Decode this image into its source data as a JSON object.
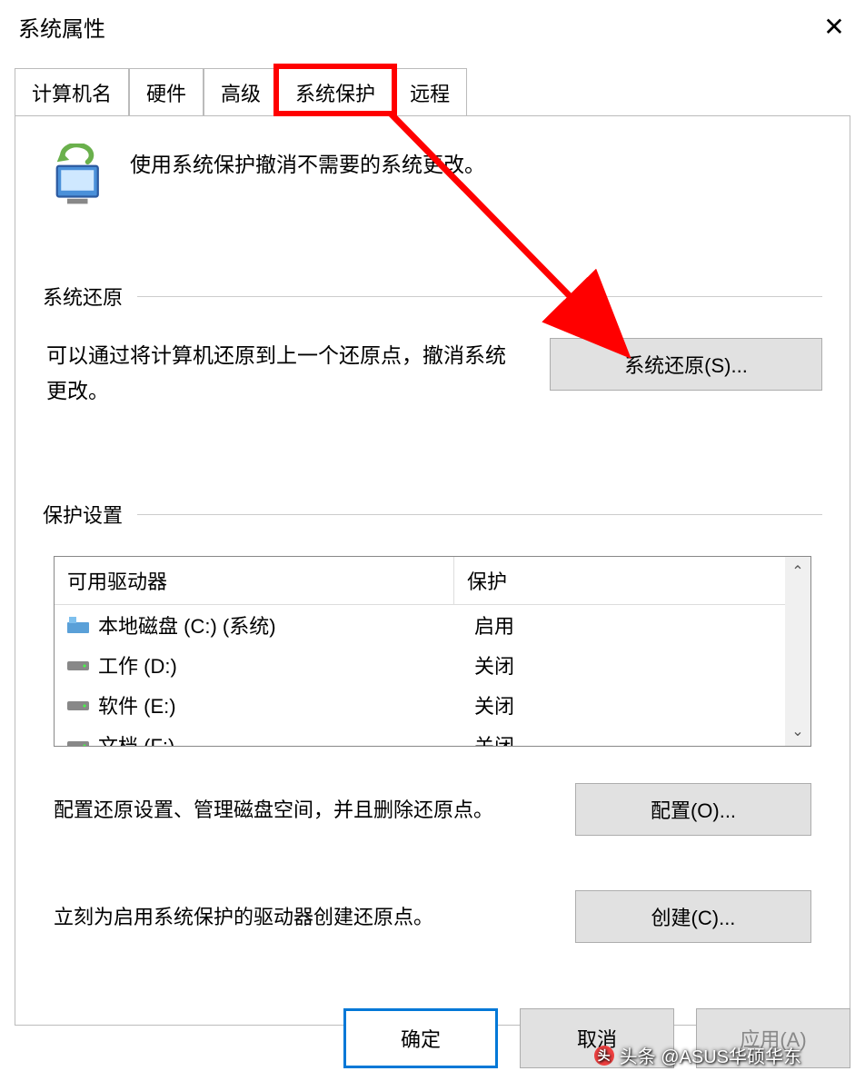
{
  "window": {
    "title": "系统属性"
  },
  "tabs": {
    "items": [
      {
        "label": "计算机名"
      },
      {
        "label": "硬件"
      },
      {
        "label": "高级"
      },
      {
        "label": "系统保护"
      },
      {
        "label": "远程"
      }
    ],
    "active_index": 3
  },
  "intro": {
    "text": "使用系统保护撤消不需要的系统更改。"
  },
  "restore_section": {
    "heading": "系统还原",
    "description": "可以通过将计算机还原到上一个还原点，撤消系统更改。",
    "button_label": "系统还原(S)..."
  },
  "protection_section": {
    "heading": "保护设置",
    "columns": {
      "drive": "可用驱动器",
      "status": "保护"
    },
    "drives": [
      {
        "name": "本地磁盘 (C:) (系统)",
        "status": "启用",
        "type": "system"
      },
      {
        "name": "工作 (D:)",
        "status": "关闭",
        "type": "hdd"
      },
      {
        "name": "软件 (E:)",
        "status": "关闭",
        "type": "hdd"
      },
      {
        "name": "文档 (F:)",
        "status": "关闭",
        "type": "hdd"
      }
    ],
    "configure_text": "配置还原设置、管理磁盘空间，并且删除还原点。",
    "configure_button": "配置(O)...",
    "create_text": "立刻为启用系统保护的驱动器创建还原点。",
    "create_button": "创建(C)..."
  },
  "footer": {
    "ok": "确定",
    "cancel": "取消",
    "apply": "应用(A)"
  },
  "watermark": "头条 @ASUS华硕华东"
}
